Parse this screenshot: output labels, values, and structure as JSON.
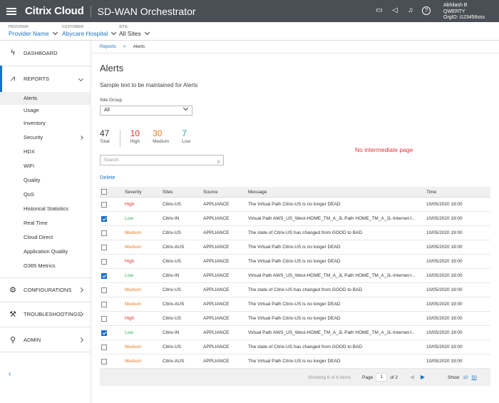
{
  "header": {
    "brand": "Citrix Cloud",
    "app_title": "SD-WAN Orchestrator",
    "icons": [
      "chat-icon",
      "announcement-icon",
      "bell-icon",
      "help-icon"
    ],
    "user": {
      "name": "Abhilash B",
      "org": "QWERTY",
      "org_id": "OrgID: i123456sss"
    }
  },
  "context": {
    "provider_label": "PROVIDER:",
    "provider_value": "Provider Name",
    "customer_label": "CUSTOMER:",
    "customer_value": "Abycare Hospital",
    "site_label": "SITE:",
    "site_value": "All Sites"
  },
  "sidebar": {
    "dashboard": "DASHBOARD",
    "reports": "REPORTS",
    "report_items": [
      "Alerts",
      "Usage",
      "Inventory",
      "Security",
      "HDX",
      "WiFi",
      "Quality",
      "QoS",
      "Historical Statistics",
      "Real Time",
      "Cloud Direct",
      "Application Quality",
      "O365 Metrics"
    ],
    "configurations": "CONFIGURATIONS",
    "troubleshootings": "TROUBLESHOOTINGS",
    "admin": "ADMIN"
  },
  "breadcrumb": {
    "parent": "Reports",
    "current": "Alerts"
  },
  "page": {
    "title": "Alerts",
    "sample_text": "Sample text to be maintained for Alerts",
    "site_group_label": "Site Group",
    "site_group_value": "All",
    "no_intermediate": "No intermediate page",
    "search_placeholder": "Search",
    "delete_label": "Delete"
  },
  "stats": {
    "total": {
      "num": "47",
      "label": "Total"
    },
    "high": {
      "num": "10",
      "label": "High"
    },
    "medium": {
      "num": "30",
      "label": "Medium"
    },
    "low": {
      "num": "7",
      "label": "Low"
    }
  },
  "colors": {
    "accent": "#1a73c4",
    "high": "#e03131",
    "medium": "#e87c22",
    "low": "#37a95a"
  },
  "table": {
    "headers": {
      "severity": "Severity",
      "sites": "Sites",
      "source": "Source",
      "message": "Message",
      "time": "Time"
    },
    "rows": [
      {
        "checked": false,
        "severity": "High",
        "site": "Citrix-US",
        "source": "APPLIANCE",
        "message": "The Virtual Path Citrix-US is no longer DEAD",
        "time": "10/05/2020 19:00"
      },
      {
        "checked": true,
        "severity": "Low",
        "site": "Citrix-IN",
        "source": "APPLIANCE",
        "message": "Virtual Path AWS_US_West-HOME_TM_A_JL Path HOME_TM_A_JL-Internet-I...",
        "time": "10/05/2020 19:00"
      },
      {
        "checked": false,
        "severity": "Medium",
        "site": "Citrix-US",
        "source": "APPLIANCE",
        "message": "The state of Citrix-US has changed from GOOD to BAD",
        "time": "10/05/2020 19:00"
      },
      {
        "checked": false,
        "severity": "Medium",
        "site": "Citrix-AUS",
        "source": "APPLIANCE",
        "message": "The Virtual Path Citrix-US is no longer DEAD",
        "time": "10/05/2020 19:00"
      },
      {
        "checked": false,
        "severity": "High",
        "site": "Citrix-US",
        "source": "APPLIANCE",
        "message": "The Virtual Path Citrix-US is no longer DEAD",
        "time": "10/05/2020 19:00"
      },
      {
        "checked": true,
        "severity": "Low",
        "site": "Citrix-IN",
        "source": "APPLIANCE",
        "message": "Virtual Path AWS_US_West-HOME_TM_A_JL Path HOME_TM_A_JL-Internet-I...",
        "time": "10/05/2020 19:00"
      },
      {
        "checked": false,
        "severity": "Medium",
        "site": "Citrix-US",
        "source": "APPLIANCE",
        "message": "The state of Citrix-US has changed from GOOD to BAD",
        "time": "10/05/2020 19:00"
      },
      {
        "checked": false,
        "severity": "Medium",
        "site": "Citrix-AUS",
        "source": "APPLIANCE",
        "message": "The Virtual Path Citrix-US is no longer DEAD",
        "time": "10/05/2020 19:00"
      },
      {
        "checked": false,
        "severity": "High",
        "site": "Citrix-US",
        "source": "APPLIANCE",
        "message": "The Virtual Path Citrix-US is no longer DEAD",
        "time": "10/05/2020 19:00"
      },
      {
        "checked": true,
        "severity": "Low",
        "site": "Citrix-IN",
        "source": "APPLIANCE",
        "message": "Virtual Path AWS_US_West-HOME_TM_A_JL Path HOME_TM_A_JL-Internet-I...",
        "time": "10/05/2020 19:00"
      },
      {
        "checked": false,
        "severity": "Medium",
        "site": "Citrix-US",
        "source": "APPLIANCE",
        "message": "The state of Citrix-US has changed from GOOD to BAD",
        "time": "10/05/2020 19:00"
      },
      {
        "checked": false,
        "severity": "Medium",
        "site": "Citrix-AUS",
        "source": "APPLIANCE",
        "message": "The Virtual Path Citrix-US is no longer DEAD",
        "time": "10/05/2020 19:00"
      }
    ]
  },
  "pagination": {
    "showing": "Showing 6 of 6 items",
    "page_label": "Page",
    "page_value": "1",
    "of_label": "of 2",
    "show_label": "Show",
    "show_options": [
      "10",
      "50"
    ]
  }
}
